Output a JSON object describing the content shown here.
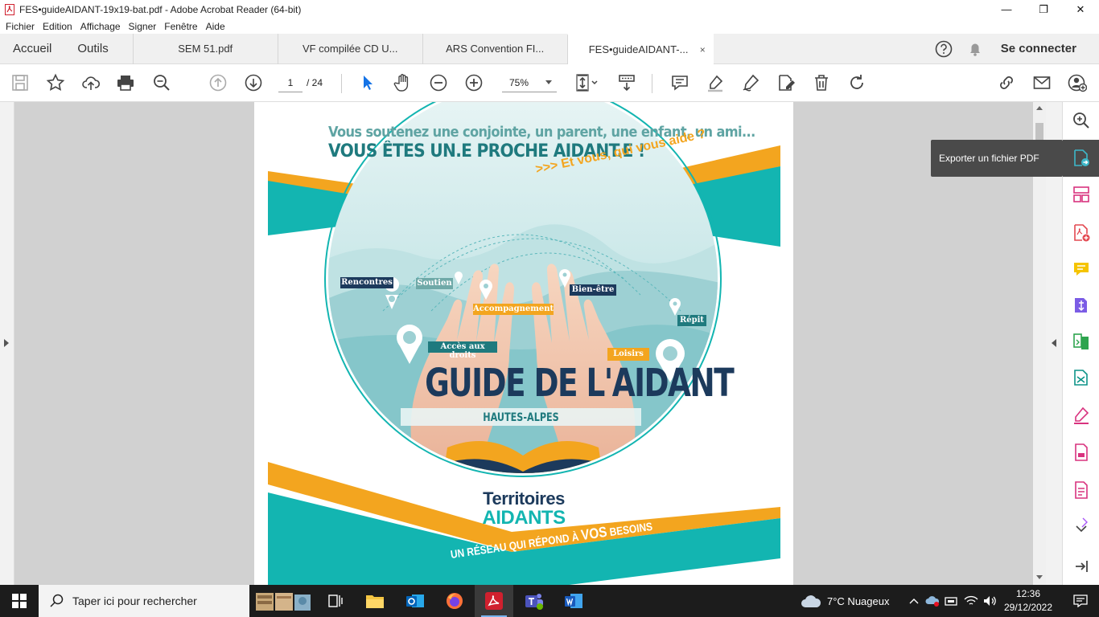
{
  "window": {
    "title": "FES•guideAIDANT-19x19-bat.pdf - Adobe Acrobat Reader (64-bit)",
    "minimize": "—",
    "maximize": "❐",
    "close": "✕"
  },
  "menubar": {
    "items": [
      "Fichier",
      "Edition",
      "Affichage",
      "Signer",
      "Fenêtre",
      "Aide"
    ]
  },
  "tabbar": {
    "home": "Accueil",
    "tools": "Outils",
    "tabs": [
      {
        "label": "SEM 51.pdf"
      },
      {
        "label": "VF compilée CD U..."
      },
      {
        "label": "ARS Convention FI..."
      },
      {
        "label": "FES•guideAIDANT-..."
      }
    ],
    "active_close": "×",
    "login": "Se connecter"
  },
  "toolbar": {
    "current_page": "1",
    "page_total": "/ 24",
    "zoom": "75%"
  },
  "tooltip": {
    "text": "Exporter un fichier PDF"
  },
  "document": {
    "tagline": "Vous soutenez une conjointe, un parent, une enfant, un ami...",
    "headline": "VOUS ÊTES UN.E PROCHE AIDANT.E !",
    "question": ">>> Et vous, qui vous aide ?",
    "labels": {
      "rencontres": "Rencontres",
      "soutien": "Soutien",
      "accompagnement": "Accompagnement",
      "bien_etre": "Bien-être",
      "repit": "Répit",
      "acces": "Accès aux droits",
      "loisirs": "Loisirs"
    },
    "main_title": "GUIDE DE L'AIDANT",
    "subtitle": "HAUTES-ALPES",
    "network_line1": "Territoires",
    "network_line2": "AIDANTS",
    "slogan_a": "UN RÉSEAU QUI RÉPOND À ",
    "slogan_b": "VOS",
    "slogan_c": " BESOINS",
    "colors": {
      "teal": "#13b5b1",
      "orange": "#f3a51f",
      "navy": "#1c3a5c",
      "dark_teal": "#1f7a7e"
    }
  },
  "taskbar": {
    "search_placeholder": "Taper ici pour rechercher",
    "weather": "7°C  Nuageux",
    "time": "12:36",
    "date": "29/12/2022"
  }
}
